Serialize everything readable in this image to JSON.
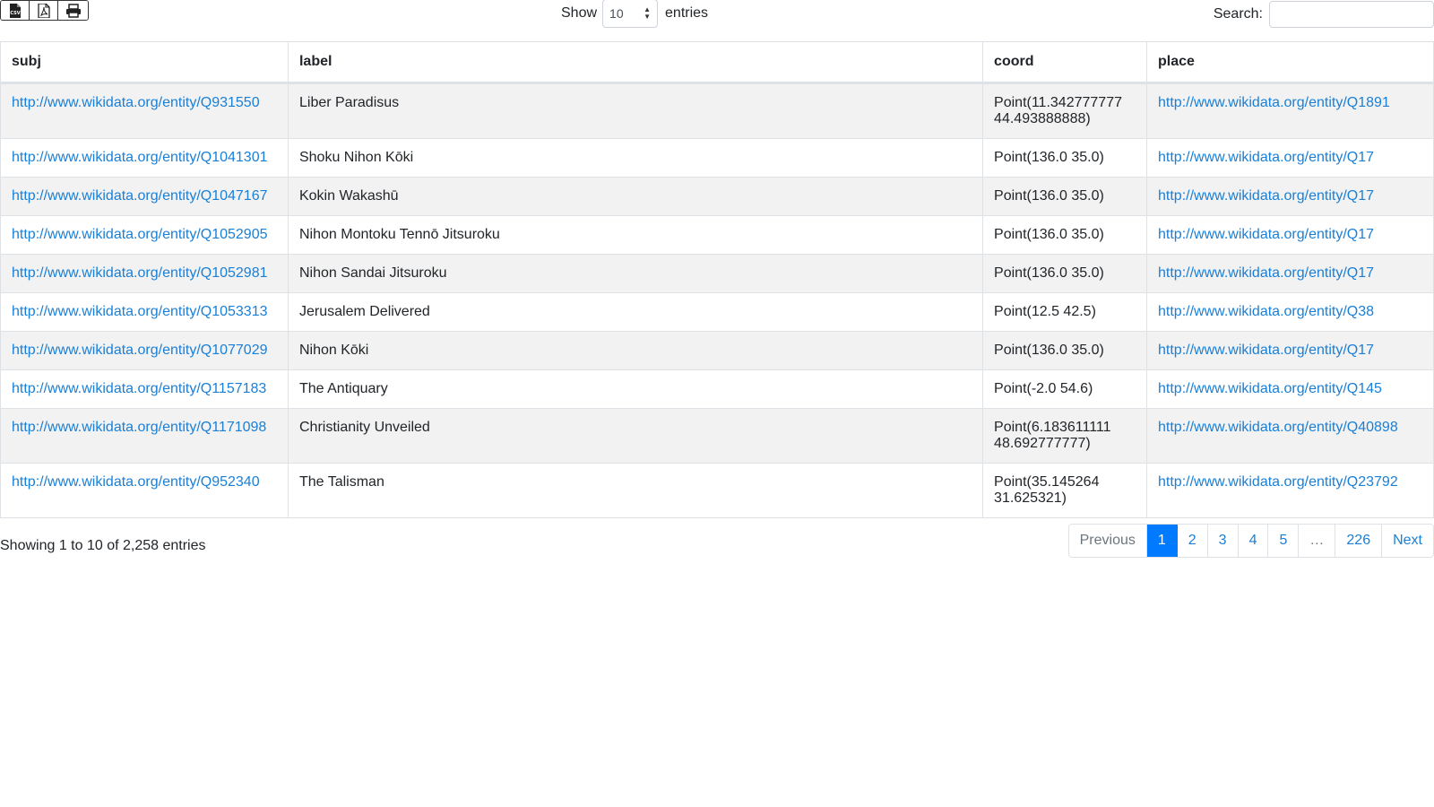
{
  "toolbar": {
    "buttons": [
      {
        "name": "csv-export-button",
        "icon": "csv-file-icon"
      },
      {
        "name": "pdf-export-button",
        "icon": "pdf-file-icon"
      },
      {
        "name": "print-button",
        "icon": "printer-icon"
      }
    ],
    "show_label": "Show",
    "entries_label": "entries",
    "page_length": "10",
    "page_length_options": [
      "10"
    ],
    "search_label": "Search:",
    "search_value": ""
  },
  "table": {
    "columns": [
      "subj",
      "label",
      "coord",
      "place"
    ],
    "rows": [
      [
        "http://www.wikidata.org/entity/Q931550",
        "Liber Paradisus",
        "Point(11.342777777 44.493888888)",
        "http://www.wikidata.org/entity/Q1891"
      ],
      [
        "http://www.wikidata.org/entity/Q1041301",
        "Shoku Nihon Kōki",
        "Point(136.0 35.0)",
        "http://www.wikidata.org/entity/Q17"
      ],
      [
        "http://www.wikidata.org/entity/Q1047167",
        "Kokin Wakashū",
        "Point(136.0 35.0)",
        "http://www.wikidata.org/entity/Q17"
      ],
      [
        "http://www.wikidata.org/entity/Q1052905",
        "Nihon Montoku Tennō Jitsuroku",
        "Point(136.0 35.0)",
        "http://www.wikidata.org/entity/Q17"
      ],
      [
        "http://www.wikidata.org/entity/Q1052981",
        "Nihon Sandai Jitsuroku",
        "Point(136.0 35.0)",
        "http://www.wikidata.org/entity/Q17"
      ],
      [
        "http://www.wikidata.org/entity/Q1053313",
        "Jerusalem Delivered",
        "Point(12.5 42.5)",
        "http://www.wikidata.org/entity/Q38"
      ],
      [
        "http://www.wikidata.org/entity/Q1077029",
        "Nihon Kōki",
        "Point(136.0 35.0)",
        "http://www.wikidata.org/entity/Q17"
      ],
      [
        "http://www.wikidata.org/entity/Q1157183",
        "The Antiquary",
        "Point(-2.0 54.6)",
        "http://www.wikidata.org/entity/Q145"
      ],
      [
        "http://www.wikidata.org/entity/Q1171098",
        "Christianity Unveiled",
        "Point(6.183611111 48.692777777)",
        "http://www.wikidata.org/entity/Q40898"
      ],
      [
        "http://www.wikidata.org/entity/Q952340",
        "The Talisman",
        "Point(35.145264 31.625321)",
        "http://www.wikidata.org/entity/Q23792"
      ]
    ]
  },
  "footer": {
    "info": "Showing 1 to 10 of 2,258 entries",
    "pages": [
      {
        "label": "Previous",
        "state": "disabled"
      },
      {
        "label": "1",
        "state": "active"
      },
      {
        "label": "2",
        "state": ""
      },
      {
        "label": "3",
        "state": ""
      },
      {
        "label": "4",
        "state": ""
      },
      {
        "label": "5",
        "state": ""
      },
      {
        "label": "…",
        "state": "disabled"
      },
      {
        "label": "226",
        "state": ""
      },
      {
        "label": "Next",
        "state": ""
      }
    ]
  },
  "colors": {
    "link": "#1a7fd6",
    "active_page": "#007bff",
    "stripe": "#f2f2f2"
  }
}
